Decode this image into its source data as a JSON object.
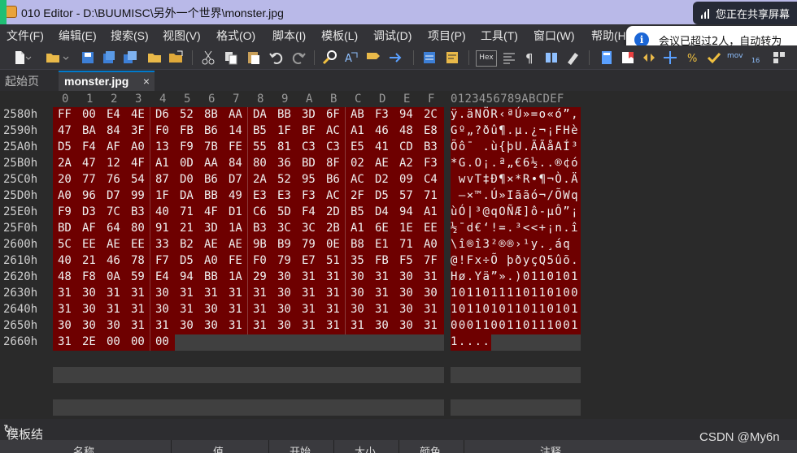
{
  "window": {
    "title": "010 Editor - D:\\BUUMISC\\另外一个世界\\monster.jpg",
    "share_notice": "您正在共享屏幕"
  },
  "notification": {
    "text": "会议已超过2人，自动转为"
  },
  "menu": [
    "文件(F)",
    "编辑(E)",
    "搜索(S)",
    "视图(V)",
    "格式(O)",
    "脚本(I)",
    "模板(L)",
    "调试(D)",
    "项目(P)",
    "工具(T)",
    "窗口(W)",
    "帮助(H)"
  ],
  "toolbar": {
    "hex_label": "Hex",
    "mov_label": "mov",
    "num_label": "16"
  },
  "tabs": {
    "start": "起始页",
    "active": "monster.jpg",
    "close": "×"
  },
  "hex": {
    "columns": [
      "0",
      "1",
      "2",
      "3",
      "4",
      "5",
      "6",
      "7",
      "8",
      "9",
      "A",
      "B",
      "C",
      "D",
      "E",
      "F"
    ],
    "char_header": "0123456789ABCDEF",
    "rows": [
      {
        "addr": "2580h",
        "bytes": [
          "FF",
          "00",
          "E4",
          "4E",
          "D6",
          "52",
          "8B",
          "AA",
          "DA",
          "BB",
          "3D",
          "6F",
          "AB",
          "F3",
          "94",
          "2C"
        ],
        "chars": "ÿ.äNÖR‹ªÚ»=o«ó”,"
      },
      {
        "addr": "2590h",
        "bytes": [
          "47",
          "BA",
          "84",
          "3F",
          "F0",
          "FB",
          "B6",
          "14",
          "B5",
          "1F",
          "BF",
          "AC",
          "A1",
          "46",
          "48",
          "E8"
        ],
        "chars": "Gº„?ðû¶.µ.¿¬¡FHè"
      },
      {
        "addr": "25A0h",
        "bytes": [
          "D5",
          "F4",
          "AF",
          "A0",
          "13",
          "F9",
          "7B",
          "FE",
          "55",
          "81",
          "C3",
          "C3",
          "E5",
          "41",
          "CD",
          "B3"
        ],
        "chars": "Õô¯ .ù{þU.ÃÃåAÍ³"
      },
      {
        "addr": "25B0h",
        "bytes": [
          "2A",
          "47",
          "12",
          "4F",
          "A1",
          "0D",
          "AA",
          "84",
          "80",
          "36",
          "BD",
          "8F",
          "02",
          "AE",
          "A2",
          "F3"
        ],
        "chars": "*G.O¡.ª„€6½..®¢ó"
      },
      {
        "addr": "25C0h",
        "bytes": [
          "20",
          "77",
          "76",
          "54",
          "87",
          "D0",
          "B6",
          "D7",
          "2A",
          "52",
          "95",
          "B6",
          "AC",
          "D2",
          "09",
          "C4"
        ],
        "chars": " wvT‡Ð¶×*R•¶¬Ò.Ä"
      },
      {
        "addr": "25D0h",
        "bytes": [
          "A0",
          "96",
          "D7",
          "99",
          "1F",
          "DA",
          "BB",
          "49",
          "E3",
          "E3",
          "F3",
          "AC",
          "2F",
          "D5",
          "57",
          "71"
        ],
        "chars": " –×™.Ú»Iããó¬/ÕWq"
      },
      {
        "addr": "25E0h",
        "bytes": [
          "F9",
          "D3",
          "7C",
          "B3",
          "40",
          "71",
          "4F",
          "D1",
          "C6",
          "5D",
          "F4",
          "2D",
          "B5",
          "D4",
          "94",
          "A1"
        ],
        "chars": "ùÓ|³@qOÑÆ]ô-µÔ”¡"
      },
      {
        "addr": "25F0h",
        "bytes": [
          "BD",
          "AF",
          "64",
          "80",
          "91",
          "21",
          "3D",
          "1A",
          "B3",
          "3C",
          "3C",
          "2B",
          "A1",
          "6E",
          "1E",
          "EE"
        ],
        "chars": "½¯d€‘!=.³<<+¡n.î"
      },
      {
        "addr": "2600h",
        "bytes": [
          "5C",
          "EE",
          "AE",
          "EE",
          "33",
          "B2",
          "AE",
          "AE",
          "9B",
          "B9",
          "79",
          "0E",
          "B8",
          "E1",
          "71",
          "A0"
        ],
        "chars": "\\î®î3²®®›¹y.¸áq "
      },
      {
        "addr": "2610h",
        "bytes": [
          "40",
          "21",
          "46",
          "78",
          "F7",
          "D5",
          "A0",
          "FE",
          "F0",
          "79",
          "E7",
          "51",
          "35",
          "FB",
          "F5",
          "7F"
        ],
        "chars": "@!Fx÷Õ þðyçQ5ûõ."
      },
      {
        "addr": "2620h",
        "bytes": [
          "48",
          "F8",
          "0A",
          "59",
          "E4",
          "94",
          "BB",
          "1A",
          "29",
          "30",
          "31",
          "31",
          "30",
          "31",
          "30",
          "31"
        ],
        "chars": "Hø.Yä”».)0110101"
      },
      {
        "addr": "2630h",
        "bytes": [
          "31",
          "30",
          "31",
          "31",
          "30",
          "31",
          "31",
          "31",
          "31",
          "30",
          "31",
          "31",
          "30",
          "31",
          "30",
          "30"
        ],
        "chars": "1011011110110100"
      },
      {
        "addr": "2640h",
        "bytes": [
          "31",
          "30",
          "31",
          "31",
          "30",
          "31",
          "30",
          "31",
          "31",
          "30",
          "31",
          "31",
          "30",
          "31",
          "30",
          "31"
        ],
        "chars": "1011010110110101"
      },
      {
        "addr": "2650h",
        "bytes": [
          "30",
          "30",
          "30",
          "31",
          "31",
          "30",
          "30",
          "31",
          "31",
          "30",
          "31",
          "31",
          "31",
          "30",
          "30",
          "31"
        ],
        "chars": "0001100110111001"
      },
      {
        "addr": "2660h",
        "bytes": [
          "31",
          "2E",
          "00",
          "00",
          "00"
        ],
        "chars": "1...."
      }
    ]
  },
  "bottom_panel": {
    "title": "模板结果 - JPG.bt",
    "refresh_icon": "↻",
    "columns": [
      "名称",
      "值",
      "开始",
      "大小",
      "颜色",
      "注释"
    ]
  },
  "watermark": "CSDN @My6n",
  "colors": {
    "selection": "#6e0000",
    "titlebar": "#b9b9e8",
    "accent": "#007acc"
  }
}
